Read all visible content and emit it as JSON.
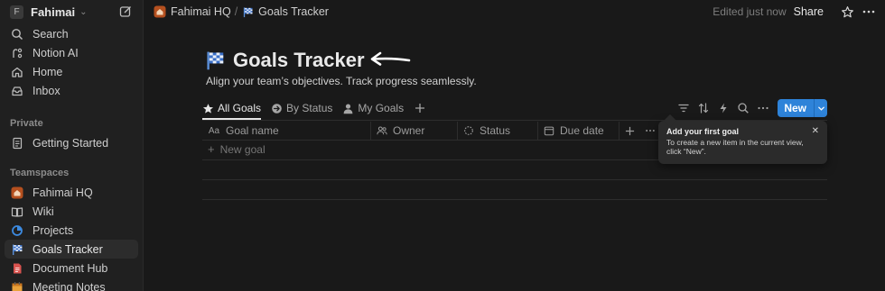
{
  "workspace": {
    "initial": "F",
    "name": "Fahimai"
  },
  "sidebar": {
    "top_items": [
      {
        "label": "Search",
        "icon": "search-icon"
      },
      {
        "label": "Notion AI",
        "icon": "notion-ai-icon"
      },
      {
        "label": "Home",
        "icon": "home-icon"
      },
      {
        "label": "Inbox",
        "icon": "inbox-icon"
      }
    ],
    "private_label": "Private",
    "private_items": [
      {
        "label": "Getting Started",
        "icon": "page-icon"
      }
    ],
    "teamspaces_label": "Teamspaces",
    "teamspace": {
      "label": "Fahimai HQ",
      "icon": "house-icon"
    },
    "team_items": [
      {
        "label": "Wiki",
        "icon": "book-icon"
      },
      {
        "label": "Projects",
        "icon": "projects-icon"
      },
      {
        "label": "Goals Tracker",
        "icon": "flag-icon"
      },
      {
        "label": "Document Hub",
        "icon": "document-icon"
      },
      {
        "label": "Meeting Notes",
        "icon": "calendar-icon"
      }
    ]
  },
  "topbar": {
    "crumb_1": "Fahimai HQ",
    "crumb_sep": "/",
    "crumb_2": "Goals Tracker",
    "edited": "Edited just now",
    "share": "Share"
  },
  "page": {
    "title": "Goals Tracker",
    "subtitle": "Align your team’s objectives. Track progress seamlessly."
  },
  "tabs": [
    "All Goals",
    "By Status",
    "My Goals"
  ],
  "new_button": "New",
  "table": {
    "columns": [
      "Goal name",
      "Owner",
      "Status",
      "Due date"
    ],
    "add_row": "New goal"
  },
  "tooltip": {
    "title": "Add your first goal",
    "body": "To create a new item in the current view, click “New”."
  },
  "colors": {
    "accent": "#2e83d9",
    "background": "#191919",
    "sidebar": "#202020"
  }
}
